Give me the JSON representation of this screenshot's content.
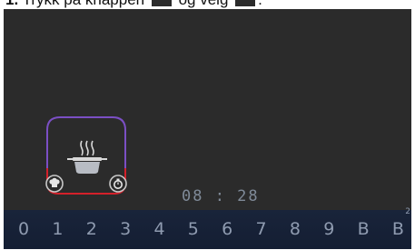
{
  "instruction": {
    "step": "1.",
    "text_before": "Trykk på knappen",
    "text_middle": "og velg",
    "text_end": "."
  },
  "display": {
    "time": "08 : 28",
    "zone": {
      "top_color": "#7b4fc4",
      "bottom_color": "#d4202a",
      "icons": [
        "steam-icon",
        "pot-icon",
        "chef-hat-icon",
        "timer-icon"
      ]
    }
  },
  "power_bar": {
    "levels": [
      {
        "label": "0",
        "sup": ""
      },
      {
        "label": "1",
        "sup": ""
      },
      {
        "label": "2",
        "sup": ""
      },
      {
        "label": "3",
        "sup": ""
      },
      {
        "label": "4",
        "sup": ""
      },
      {
        "label": "5",
        "sup": ""
      },
      {
        "label": "6",
        "sup": ""
      },
      {
        "label": "7",
        "sup": ""
      },
      {
        "label": "8",
        "sup": ""
      },
      {
        "label": "9",
        "sup": ""
      },
      {
        "label": "B",
        "sup": ""
      },
      {
        "label": "B",
        "sup": "2"
      }
    ]
  }
}
